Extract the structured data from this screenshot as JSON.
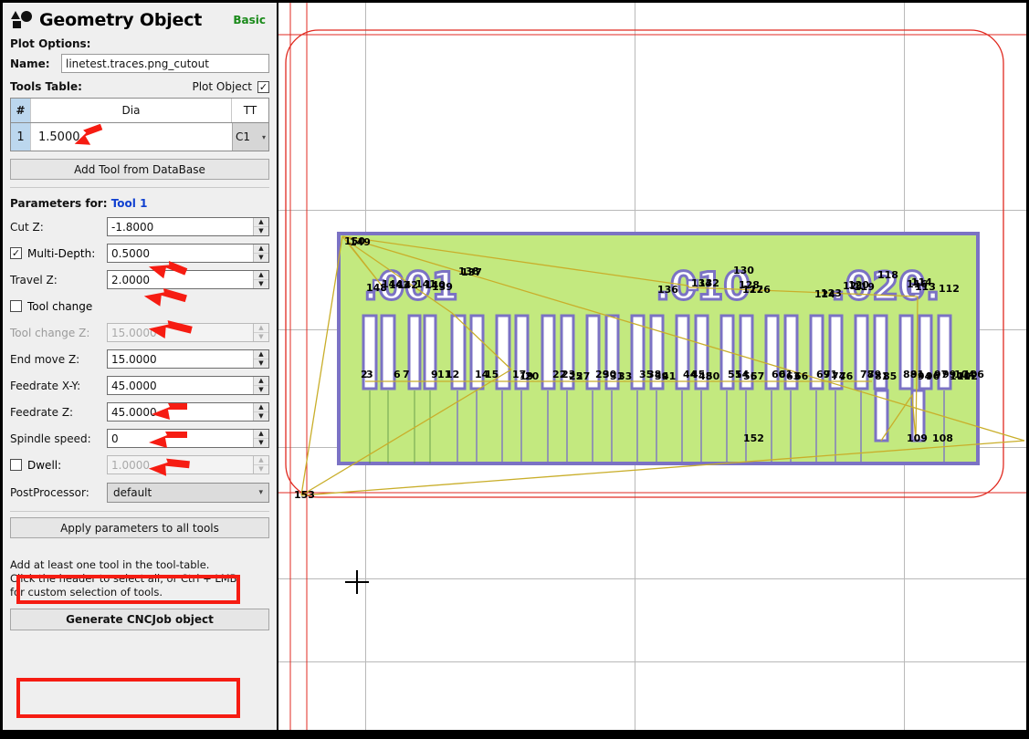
{
  "header": {
    "icon": "geometry-shapes-icon",
    "title": "Geometry Object",
    "mode": "Basic"
  },
  "plot_options": {
    "section_label": "Plot Options:",
    "name_label": "Name:",
    "name_value": "linetest.traces.png_cutout",
    "tools_table_label": "Tools Table:",
    "plot_object_label": "Plot Object",
    "plot_object_checked": true
  },
  "tools_table": {
    "columns": [
      "#",
      "Dia",
      "TT"
    ],
    "rows": [
      {
        "index": "1",
        "dia": "1.5000",
        "tt": "C1"
      }
    ],
    "add_tool_button": "Add Tool from DataBase"
  },
  "parameters": {
    "title_prefix": "Parameters for:",
    "title_tool": "Tool 1",
    "fields": [
      {
        "label": "Cut Z:",
        "value": "-1.8000",
        "disabled": false,
        "checkbox": null
      },
      {
        "label": "Multi-Depth:",
        "value": "0.5000",
        "disabled": false,
        "checkbox": true
      },
      {
        "label": "Travel Z:",
        "value": "2.0000",
        "disabled": false,
        "checkbox": null
      },
      {
        "label": "Tool change",
        "value": "",
        "disabled": false,
        "checkbox": false
      },
      {
        "label": "Tool change Z:",
        "value": "15.0000",
        "disabled": true,
        "checkbox": null
      },
      {
        "label": "End move Z:",
        "value": "15.0000",
        "disabled": false,
        "checkbox": null
      },
      {
        "label": "Feedrate X-Y:",
        "value": "45.0000",
        "disabled": false,
        "checkbox": null
      },
      {
        "label": "Feedrate Z:",
        "value": "45.0000",
        "disabled": false,
        "checkbox": null
      },
      {
        "label": "Spindle speed:",
        "value": "0",
        "disabled": false,
        "checkbox": null
      },
      {
        "label": "Dwell:",
        "value": "1.0000",
        "disabled": true,
        "checkbox": false
      }
    ],
    "postprocessor_label": "PostProcessor:",
    "postprocessor_value": "default"
  },
  "actions": {
    "apply_all_label": "Apply parameters to all tools",
    "hint_line1": "Add at least one tool in the tool-table.",
    "hint_line2": "Click the header to select all, or Ctrl + LMB",
    "hint_line3": "for custom selection of tools.",
    "generate_label": "Generate CNCJob object"
  },
  "colors": {
    "accent_red": "#f61c12",
    "tool_link": "#1040d0",
    "mode_green": "#1a8a1a",
    "pcb_fill": "#c3e97f",
    "pcb_trace": "#7b72c4",
    "travel_path": "#c9ae2a",
    "cutout_path": "#e02a20",
    "grid": "#b9b9b9",
    "panel_bg": "#efefef"
  },
  "canvas": {
    "description": "CAM plot view of PCB geometry object with cutout path",
    "board_labels_top": [
      "150",
      "149",
      "148",
      "144",
      "143",
      "142",
      "141",
      "140",
      "139",
      "138",
      "137",
      "136",
      "134",
      "132",
      "130",
      "128",
      "127",
      "126",
      "124",
      "123",
      "121",
      "120",
      "119",
      "118",
      "116",
      "114",
      "113",
      "112"
    ],
    "board_labels_mid": [
      "2",
      "3",
      "6",
      "7",
      "9",
      "11",
      "12",
      "14",
      "15",
      "17",
      "19",
      "20",
      "22",
      "23",
      "25",
      "27",
      "29",
      "30",
      "31",
      "33",
      "35",
      "38",
      "39",
      "41",
      "44",
      "45",
      "48",
      "50",
      "51",
      "54",
      "56",
      "57",
      "60",
      "61",
      "63",
      "66",
      "69",
      "71",
      "74",
      "76",
      "78",
      "79",
      "81",
      "85",
      "88",
      "91",
      "94",
      "96",
      "97",
      "99",
      "101",
      "102",
      "104",
      "106"
    ],
    "board_labels_bottom": [
      "109",
      "108",
      "152",
      "153"
    ],
    "silkscreen_text": [
      ".001",
      ".010",
      ".020."
    ],
    "cursor": "crosshair"
  },
  "annotations": {
    "arrows": [
      {
        "target": "tools-table-dia-value"
      },
      {
        "target": "cut-z-field"
      },
      {
        "target": "multi-depth-field"
      },
      {
        "target": "travel-z-field"
      },
      {
        "target": "end-move-z-field"
      },
      {
        "target": "feedrate-xy-field"
      },
      {
        "target": "feedrate-z-field"
      }
    ],
    "boxes": [
      {
        "target": "apply-parameters-button"
      },
      {
        "target": "generate-cncjob-button"
      }
    ]
  }
}
